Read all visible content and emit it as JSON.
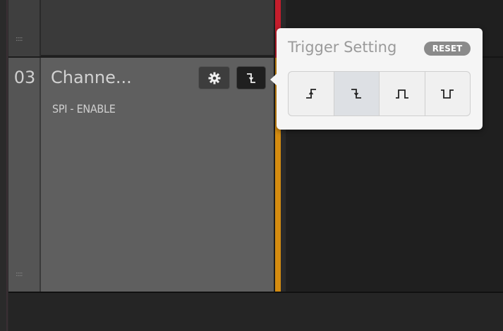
{
  "channel": {
    "number": "03",
    "name": "Channe...",
    "subtitle": "SPI - ENABLE",
    "grip": "::::"
  },
  "popover": {
    "title": "Trigger Setting",
    "reset_label": "RESET",
    "options": [
      {
        "name": "rising-edge",
        "icon": "rising-edge-icon"
      },
      {
        "name": "falling-edge",
        "icon": "falling-edge-icon",
        "selected": true
      },
      {
        "name": "positive-pulse",
        "icon": "positive-pulse-icon"
      },
      {
        "name": "negative-pulse",
        "icon": "negative-pulse-icon"
      }
    ]
  },
  "colors": {
    "cursor_top": "#c51d2c",
    "cursor_bottom": "#d48c10",
    "popover_bg": "#f5f5f5"
  }
}
